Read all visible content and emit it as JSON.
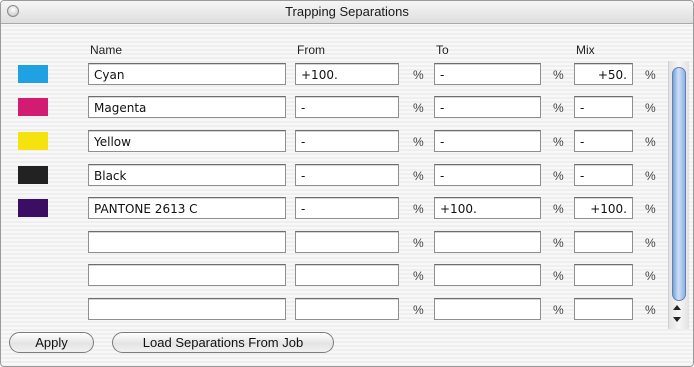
{
  "window": {
    "title": "Trapping Separations"
  },
  "columns": {
    "name": "Name",
    "from": "From",
    "to": "To",
    "mix": "Mix"
  },
  "percent_sign": "%",
  "rows": [
    {
      "color": "#1ea2e3",
      "name": "Cyan",
      "from": "+100.",
      "to": "-",
      "mix": "+50."
    },
    {
      "color": "#d21c71",
      "name": "Magenta",
      "from": "-",
      "to": "-",
      "mix": "-"
    },
    {
      "color": "#f5e310",
      "name": "Yellow",
      "from": "-",
      "to": "-",
      "mix": "-"
    },
    {
      "color": "#222222",
      "name": "Black",
      "from": "-",
      "to": "-",
      "mix": "-"
    },
    {
      "color": "#3a0e62",
      "name": "PANTONE 2613 C",
      "from": "-",
      "to": "+100.",
      "mix": "+100."
    },
    {
      "color": null,
      "name": "",
      "from": "",
      "to": "",
      "mix": ""
    },
    {
      "color": null,
      "name": "",
      "from": "",
      "to": "",
      "mix": ""
    },
    {
      "color": null,
      "name": "",
      "from": "",
      "to": "",
      "mix": ""
    }
  ],
  "buttons": {
    "apply": "Apply",
    "load": "Load Separations From Job"
  }
}
